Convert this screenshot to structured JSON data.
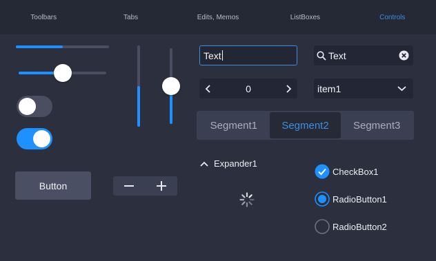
{
  "tabs": [
    {
      "label": "Toolbars",
      "active": false
    },
    {
      "label": "Tabs",
      "active": false
    },
    {
      "label": "Edits, Memos",
      "active": false
    },
    {
      "label": "ListBoxes",
      "active": false
    },
    {
      "label": "Controls",
      "active": true
    }
  ],
  "colors": {
    "accent": "#1e90ff",
    "background": "#2c2f3e",
    "tab_active": "#3d8fe0"
  },
  "sliders": {
    "progress_fraction": 0.5,
    "horizontal_value_fraction": 0.5,
    "vertical_left_fraction": 0.5,
    "vertical_right_fraction": 0.5
  },
  "toggles": [
    {
      "on": false
    },
    {
      "on": true
    }
  ],
  "button": {
    "label": "Button"
  },
  "stepper": {
    "minus_icon": "minus-icon",
    "plus_icon": "plus-icon"
  },
  "textbox": {
    "value": "Text"
  },
  "searchbox": {
    "value": "Text",
    "icons": [
      "search-icon",
      "clear-icon"
    ]
  },
  "numberbox": {
    "value": "0"
  },
  "combobox": {
    "selected": "item1"
  },
  "segments": [
    {
      "label": "Segment1",
      "active": false
    },
    {
      "label": "Segment2",
      "active": true
    },
    {
      "label": "Segment3",
      "active": false
    }
  ],
  "expander": {
    "label": "Expander1",
    "expanded": true
  },
  "checkbox": {
    "label": "CheckBox1",
    "checked": true
  },
  "radios": [
    {
      "label": "RadioButton1",
      "checked": true
    },
    {
      "label": "RadioButton2",
      "checked": false
    }
  ]
}
